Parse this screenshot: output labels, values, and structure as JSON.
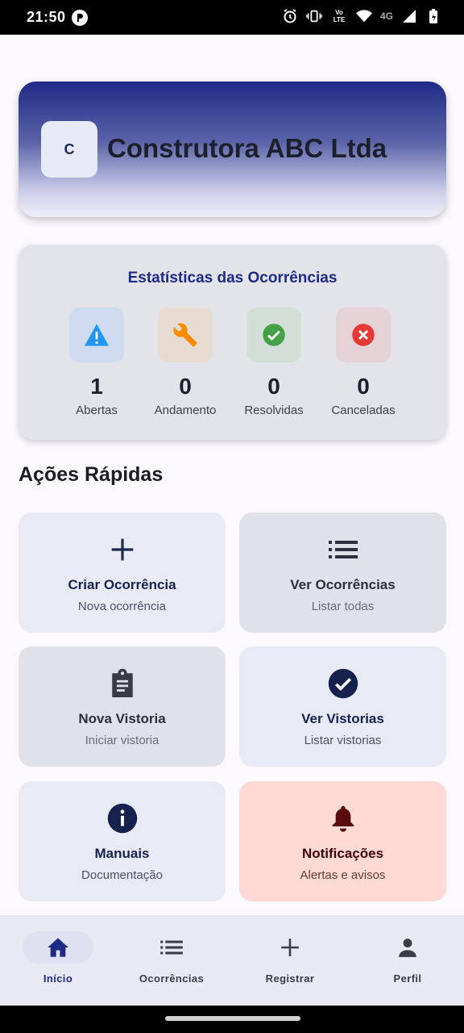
{
  "status_bar": {
    "time": "21:50",
    "network": "4G",
    "volte": "Vo LTE"
  },
  "header": {
    "logo_letter": "C",
    "company_name": "Construtora ABC Ltda"
  },
  "stats": {
    "title": "Estatísticas das Ocorrências",
    "items": [
      {
        "value": "1",
        "label": "Abertas",
        "icon": "warning-icon",
        "color": "#2196f3"
      },
      {
        "value": "0",
        "label": "Andamento",
        "icon": "wrench-icon",
        "color": "#fb8c00"
      },
      {
        "value": "0",
        "label": "Resolvidas",
        "icon": "check-circle-icon",
        "color": "#43a047"
      },
      {
        "value": "0",
        "label": "Canceladas",
        "icon": "cancel-icon",
        "color": "#e53935"
      }
    ]
  },
  "quick_actions": {
    "title": "Ações Rápidas",
    "tiles": [
      {
        "title": "Criar Ocorrência",
        "subtitle": "Nova ocorrência",
        "icon": "plus-icon"
      },
      {
        "title": "Ver Ocorrências",
        "subtitle": "Listar todas",
        "icon": "list-icon"
      },
      {
        "title": "Nova Vistoria",
        "subtitle": "Iniciar vistoria",
        "icon": "clipboard-icon"
      },
      {
        "title": "Ver Vistorias",
        "subtitle": "Listar vistorias",
        "icon": "check-circle-icon"
      },
      {
        "title": "Manuais",
        "subtitle": "Documentação",
        "icon": "info-icon"
      },
      {
        "title": "Notificações",
        "subtitle": "Alertas e avisos",
        "icon": "bell-icon"
      }
    ]
  },
  "bottom_nav": {
    "items": [
      {
        "label": "Início",
        "icon": "home-icon",
        "active": true
      },
      {
        "label": "Ocorrências",
        "icon": "list-icon",
        "active": false
      },
      {
        "label": "Registrar",
        "icon": "plus-icon",
        "active": false
      },
      {
        "label": "Perfil",
        "icon": "person-icon",
        "active": false
      }
    ]
  },
  "colors": {
    "primary": "#1d2b86",
    "stats_bg": "#e2e4ea",
    "notification_tile": "#ffdad5"
  }
}
